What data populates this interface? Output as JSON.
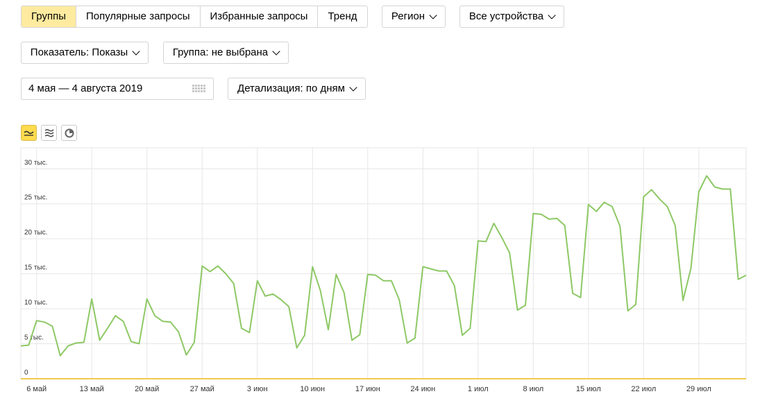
{
  "tabs": [
    {
      "label": "Группы",
      "active": true
    },
    {
      "label": "Популярные запросы",
      "active": false
    },
    {
      "label": "Избранные запросы",
      "active": false
    },
    {
      "label": "Тренд",
      "active": false
    }
  ],
  "filters": {
    "region": "Регион",
    "devices": "Все устройства",
    "metric": "Показатель: Показы",
    "group": "Группа: не выбрана",
    "date_range": "4 мая — 4 августа 2019",
    "detail": "Детализация: по дням"
  },
  "view_modes": [
    {
      "name": "line-chart-icon",
      "active": true
    },
    {
      "name": "stacked-area-icon",
      "active": false
    },
    {
      "name": "pie-chart-icon",
      "active": false
    }
  ],
  "colors": {
    "line": "#8dc865",
    "grid": "#e6e6e6",
    "accent": "#ffdb4d",
    "axis": "#f2c94c"
  },
  "chart_data": {
    "type": "line",
    "y_tick_labels": [
      "0",
      "5 тыс.",
      "10 тыс.",
      "15 тыс.",
      "20 тыс.",
      "25 тыс.",
      "30 тыс."
    ],
    "x_tick_labels": [
      "6 май",
      "13 май",
      "20 май",
      "27 май",
      "3 июн",
      "10 июн",
      "17 июн",
      "24 июн",
      "1 июл",
      "8 июл",
      "15 июл",
      "22 июл",
      "29 июл"
    ],
    "ylim": [
      0,
      33000
    ],
    "grid": true,
    "series": [
      {
        "values": [
          4700,
          4800,
          8300,
          8100,
          7500,
          3300,
          4700,
          5100,
          5200,
          11400,
          5500,
          7200,
          9000,
          8200,
          5300,
          5000,
          11400,
          9000,
          8200,
          8100,
          6700,
          3400,
          5200,
          16100,
          15300,
          16100,
          15000,
          13600,
          7200,
          6600,
          14000,
          11800,
          12100,
          11300,
          10300,
          4400,
          6200,
          16000,
          12600,
          7000,
          14900,
          12300,
          5500,
          6300,
          14900,
          14800,
          14000,
          14000,
          11300,
          5100,
          5800,
          16000,
          15700,
          15400,
          15400,
          13300,
          6200,
          7200,
          19700,
          19600,
          22200,
          20200,
          18000,
          9800,
          10500,
          23600,
          23500,
          22800,
          22900,
          21900,
          12200,
          11600,
          24900,
          23900,
          25200,
          24600,
          21800,
          9700,
          10600,
          26000,
          27000,
          25700,
          24600,
          21900,
          11200,
          15800,
          26700,
          29000,
          27400,
          27100,
          27100,
          14200,
          14800
        ]
      }
    ]
  }
}
